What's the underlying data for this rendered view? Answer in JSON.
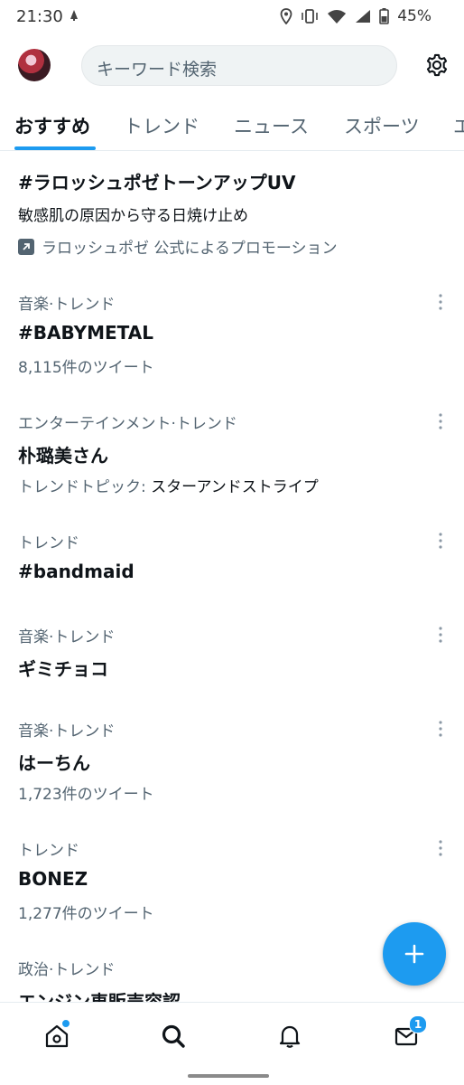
{
  "status_bar": {
    "time": "21:30",
    "battery": "45%",
    "icons": [
      "notification-icon",
      "location-icon",
      "vibrate-icon",
      "wifi-icon",
      "signal-icon",
      "battery-icon"
    ]
  },
  "header": {
    "search_placeholder": "キーワード検索",
    "avatar_icon": "profile-avatar",
    "settings_icon": "gear-icon"
  },
  "tabs": [
    {
      "label": "おすすめ",
      "active": true
    },
    {
      "label": "トレンド",
      "active": false
    },
    {
      "label": "ニュース",
      "active": false
    },
    {
      "label": "スポーツ",
      "active": false
    },
    {
      "label": "エ",
      "active": false
    }
  ],
  "promo": {
    "title": "#ラロッシュポゼトーンアップUV",
    "description": "敏感肌の原因から守る日焼け止め",
    "byline": "ラロッシュポゼ 公式によるプロモーション"
  },
  "trends": [
    {
      "context": "音楽·トレンド",
      "name": "#BABYMETAL",
      "meta": "8,115件のツイート"
    },
    {
      "context": "エンターテインメント·トレンド",
      "name": "朴璐美さん",
      "meta_prefix": "トレンドトピック: ",
      "meta_highlight": "スターアンドストライプ"
    },
    {
      "context": "トレンド",
      "name": "#bandmaid"
    },
    {
      "context": "音楽·トレンド",
      "name": "ギミチョコ"
    },
    {
      "context": "音楽·トレンド",
      "name": "はーちん",
      "meta": "1,723件のツイート"
    },
    {
      "context": "トレンド",
      "name": "BONEZ",
      "meta": "1,277件のツイート"
    },
    {
      "context": "政治·トレンド",
      "name": "エンジン車販売容認"
    }
  ],
  "fab": {
    "icon": "plus-icon"
  },
  "bottom_nav": {
    "items": [
      "home-icon",
      "search-icon",
      "bell-icon",
      "mail-icon"
    ],
    "messages_badge": "1"
  },
  "colors": {
    "accent": "#1d9bf0",
    "text": "#0f1419",
    "secondary": "#536471"
  }
}
